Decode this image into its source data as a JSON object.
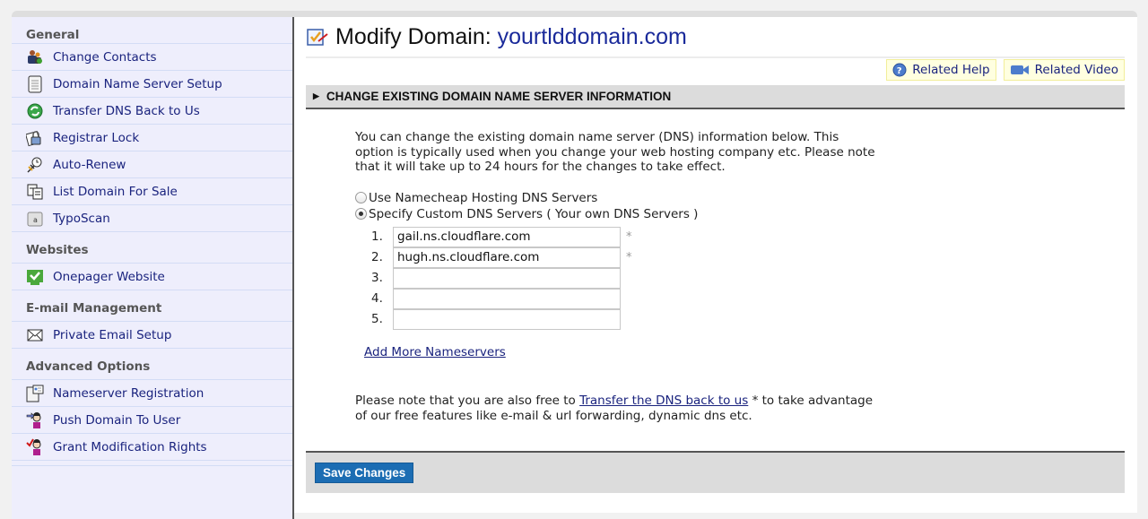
{
  "sidebar": {
    "sections": [
      {
        "title": "General",
        "items": [
          {
            "label": "Change Contacts",
            "icon": "contacts-icon"
          },
          {
            "label": "Domain Name Server Setup",
            "icon": "server-icon"
          },
          {
            "label": "Transfer DNS Back to Us",
            "icon": "transfer-icon"
          },
          {
            "label": "Registrar Lock",
            "icon": "lock-icon"
          },
          {
            "label": "Auto-Renew",
            "icon": "auto-renew-icon"
          },
          {
            "label": "List Domain For Sale",
            "icon": "list-sale-icon"
          },
          {
            "label": "TypoScan",
            "icon": "typoscan-icon"
          }
        ]
      },
      {
        "title": "Websites",
        "items": [
          {
            "label": "Onepager Website",
            "icon": "website-check-icon"
          }
        ]
      },
      {
        "title": "E-mail Management",
        "items": [
          {
            "label": "Private Email Setup",
            "icon": "envelope-icon"
          }
        ]
      },
      {
        "title": "Advanced Options",
        "items": [
          {
            "label": "Nameserver Registration",
            "icon": "nameserver-registration-icon"
          },
          {
            "label": "Push Domain To User",
            "icon": "push-user-icon"
          },
          {
            "label": "Grant Modification Rights",
            "icon": "grant-rights-icon"
          }
        ]
      }
    ]
  },
  "header": {
    "title_prefix": "Modify Domain:",
    "domain": "yourtlddomain.com",
    "related_help": "Related Help",
    "related_video": "Related Video"
  },
  "section": {
    "title": "CHANGE EXISTING DOMAIN NAME SERVER INFORMATION",
    "intro": "You can change the existing domain name server (DNS) information below. This option is typically used when you change your web hosting company etc. Please note that it will take up to 24 hours for the changes to take effect.",
    "radio_options": [
      {
        "label": "Use Namecheap Hosting DNS Servers",
        "selected": false
      },
      {
        "label": "Specify Custom DNS Servers ( Your own DNS Servers )",
        "selected": true
      }
    ],
    "nameservers": [
      {
        "num": "1.",
        "value": "gail.ns.cloudflare.com",
        "required": "*"
      },
      {
        "num": "2.",
        "value": "hugh.ns.cloudflare.com",
        "required": "*"
      },
      {
        "num": "3.",
        "value": "",
        "required": ""
      },
      {
        "num": "4.",
        "value": "",
        "required": ""
      },
      {
        "num": "5.",
        "value": "",
        "required": ""
      }
    ],
    "add_more": "Add More Nameservers",
    "note_before": "Please note that you are also free to ",
    "note_link": "Transfer the DNS back to us",
    "note_after": " * to take advantage of our free features like e-mail & url forwarding, dynamic dns etc."
  },
  "footer": {
    "save_label": "Save Changes"
  },
  "colors": {
    "link": "#1a237e",
    "save_button": "#1c6db3",
    "sidebar_bg": "#eeeefc",
    "section_bar": "#dcdcdc"
  }
}
